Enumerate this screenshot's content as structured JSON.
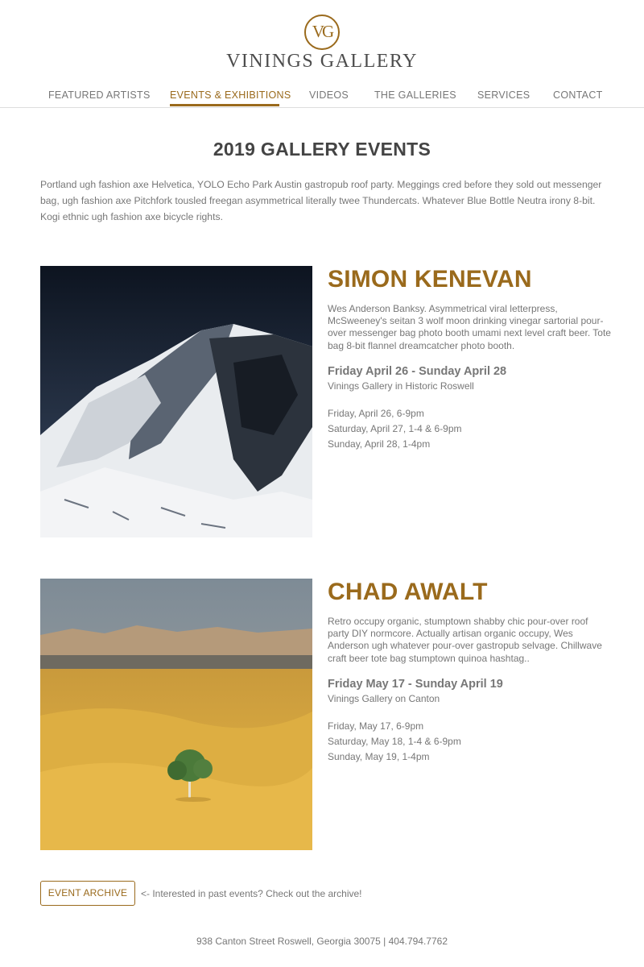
{
  "brand": {
    "monogram": "VG",
    "name": "VININGS GALLERY",
    "accent_color": "#9a6a1c"
  },
  "nav": {
    "items": [
      {
        "label": "FEATURED ARTISTS",
        "active": false
      },
      {
        "label": "EVENTS & EXHIBITIONS",
        "active": true
      },
      {
        "label": "VIDEOS",
        "active": false
      },
      {
        "label": "THE GALLERIES",
        "active": false
      },
      {
        "label": "SERVICES",
        "active": false
      },
      {
        "label": "CONTACT",
        "active": false
      }
    ]
  },
  "page": {
    "title": "2019 GALLERY EVENTS",
    "intro": "Portland ugh fashion axe Helvetica, YOLO Echo Park Austin gastropub roof party. Meggings cred before they sold out messenger bag, ugh fashion axe Pitchfork tousled freegan asymmetrical literally twee Thundercats. Whatever Blue Bottle Neutra irony 8-bit. Kogi ethnic ugh fashion axe bicycle rights."
  },
  "events": [
    {
      "artist": "SIMON KENEVAN",
      "description": "Wes Anderson Banksy. Asymmetrical viral letterpress, McSweeney's seitan 3 wolf moon drinking vinegar sartorial pour-over messenger bag photo booth umami next level craft beer. Tote bag 8-bit flannel dreamcatcher photo booth.",
      "dates": "Friday April 26 - Sunday April 28",
      "venue": "Vinings Gallery in Historic Roswell",
      "times": [
        "Friday, April 26, 6-9pm",
        "Saturday, April 27, 1-4 & 6-9pm",
        "Sunday, April 28, 1-4pm"
      ]
    },
    {
      "artist": "CHAD AWALT",
      "description": "Retro occupy organic, stumptown shabby chic pour-over roof party DIY normcore. Actually artisan organic occupy, Wes Anderson ugh whatever pour-over gastropub selvage. Chillwave craft beer tote bag stumptown quinoa hashtag..",
      "dates": "Friday May 17 - Sunday April 19",
      "venue": "Vinings Gallery on Canton",
      "times": [
        "Friday, May 17, 6-9pm",
        "Saturday, May 18, 1-4 & 6-9pm",
        "Sunday, May 19, 1-4pm"
      ]
    }
  ],
  "archive": {
    "button_label": "EVENT ARCHIVE",
    "note": "<- Interested in past events? Check out the archive!"
  },
  "footer": {
    "address": "938 Canton Street Roswell, Georgia 30075 | 404.794.7762"
  }
}
